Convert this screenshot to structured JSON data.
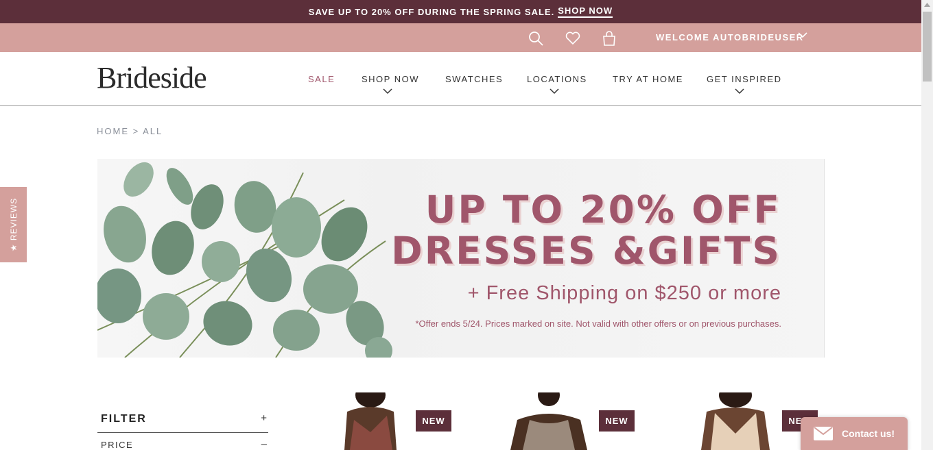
{
  "promo": {
    "text": "SAVE UP TO 20% OFF DURING THE SPRING SALE.",
    "link": "SHOP NOW"
  },
  "utility": {
    "welcome": "WELCOME AUTOBRIDEUSER",
    "icons": [
      "search-icon",
      "heart-icon",
      "shopping-bag-icon",
      "chevron-down-icon"
    ]
  },
  "header": {
    "logo": "Brideside",
    "nav": [
      {
        "label": "SALE",
        "dropdown": false
      },
      {
        "label": "SHOP NOW",
        "dropdown": true
      },
      {
        "label": "SWATCHES",
        "dropdown": false
      },
      {
        "label": "LOCATIONS",
        "dropdown": true
      },
      {
        "label": "TRY AT HOME",
        "dropdown": false
      },
      {
        "label": "GET INSPIRED",
        "dropdown": true
      }
    ]
  },
  "breadcrumb": "HOME > ALL",
  "hero": {
    "line1": "UP TO 20% OFF",
    "line2": "DRESSES &GIFTS",
    "sub": "+ Free Shipping on $250 or more",
    "fine": "*Offer ends 5/24. Prices marked on site. Not valid with other offers or on previous purchases."
  },
  "reviews_tab": "★ REVIEWS",
  "filter": {
    "title": "FILTER",
    "title_symbol": "+",
    "price": "PRICE",
    "price_symbol": "–"
  },
  "products": [
    {
      "badge": "NEW",
      "dress_color": "#8a4a40",
      "skin": "#5a3a2a"
    },
    {
      "badge": "NEW",
      "dress_color": "#9b8a7c",
      "skin": "#4a3022"
    },
    {
      "badge": "NEW",
      "dress_color": "#e6d0b8",
      "skin": "#6b4532"
    }
  ],
  "contact": {
    "label": "Contact us!"
  },
  "colors": {
    "brand_dark": "#5c2f3a",
    "brand_pink": "#d4a09c",
    "accent": "#a0566b"
  }
}
